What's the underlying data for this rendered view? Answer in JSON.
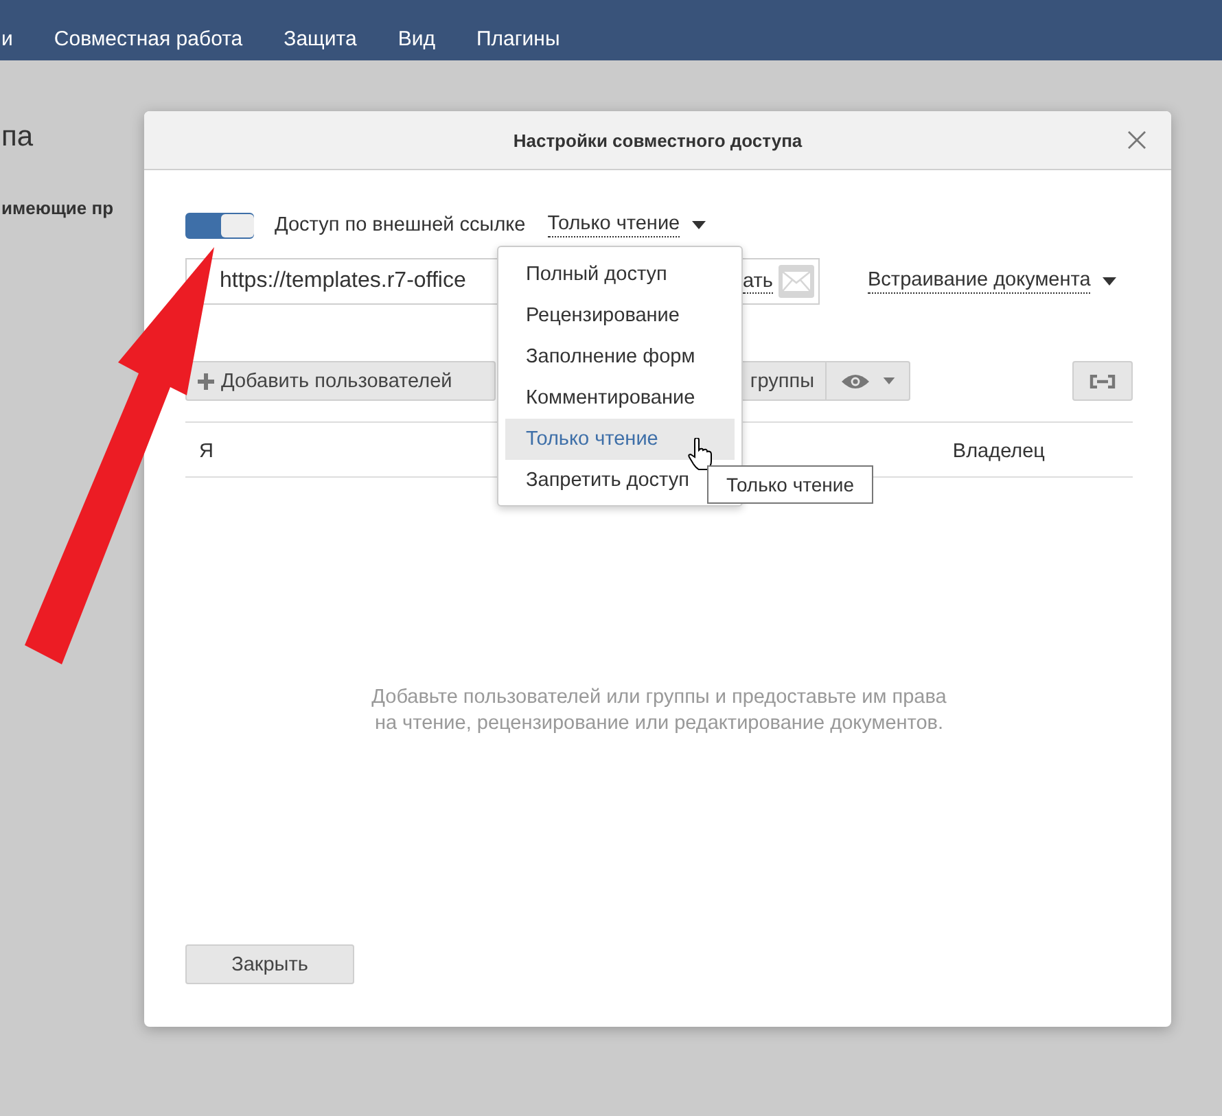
{
  "menu_bar": {
    "items": [
      "и",
      "Совместная работа",
      "Защита",
      "Вид",
      "Плагины"
    ]
  },
  "background": {
    "heading": "па",
    "label": "имеющие пр"
  },
  "dialog": {
    "title": "Настройки совместного доступа",
    "external_link": {
      "on": true,
      "label": "Доступ по внешней ссылке",
      "access": "Только чтение"
    },
    "link": {
      "value": "https://templates.r7-office",
      "send_link": "ать"
    },
    "embed": "Встраивание документа",
    "toolbar": {
      "add_users": "Добавить пользователей",
      "groups": "группы"
    },
    "rows": [
      {
        "name": "Я",
        "role": "Владелец"
      }
    ],
    "empty_message": "Добавьте пользователей или группы и предоставьте им права\nна чтение, рецензирование или редактирование документов.",
    "close_button": "Закрыть"
  },
  "access_menu": {
    "items": [
      {
        "label": "Полный доступ",
        "selected": false
      },
      {
        "label": "Рецензирование",
        "selected": false
      },
      {
        "label": "Заполнение форм",
        "selected": false
      },
      {
        "label": "Комментирование",
        "selected": false
      },
      {
        "label": "Только чтение",
        "selected": true
      },
      {
        "label": "Запретить доступ",
        "selected": false
      }
    ]
  },
  "tooltip": "Только чтение"
}
